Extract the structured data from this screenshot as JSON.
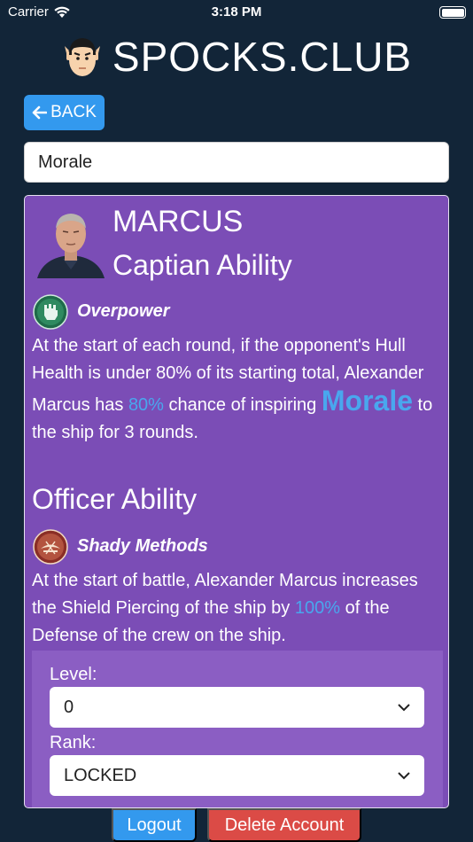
{
  "status_bar": {
    "carrier": "Carrier",
    "time": "3:18 PM"
  },
  "brand": {
    "title": "SPOCKS.CLUB",
    "logo_icon": "spock-face-icon"
  },
  "nav": {
    "back_label": "BACK",
    "back_icon": "arrow-left-icon"
  },
  "search": {
    "value": "Morale"
  },
  "officer": {
    "name": "MARCUS",
    "captain_heading": "Captian Ability",
    "captain_ability": {
      "name": "Overpower",
      "icon": "fist-icon",
      "text_1": "At the start of each round, if the opponent's Hull Health is under 80% of its starting total, Alexander Marcus has ",
      "chance": "80%",
      "text_2": " chance of inspiring ",
      "effect": "Morale",
      "text_3": " to the ship for 3 rounds."
    },
    "officer_heading": "Officer Ability",
    "officer_ability": {
      "name": "Shady Methods",
      "icon": "shady-methods-icon",
      "text_1": "At the start of battle, Alexander Marcus increases the Shield Piercing of the ship by ",
      "percent": "100%",
      "text_2": " of the Defense of the crew on the ship."
    }
  },
  "settings": {
    "level_label": "Level:",
    "level_value": "0",
    "rank_label": "Rank:",
    "rank_value": "LOCKED"
  },
  "footer": {
    "logout_label": "Logout",
    "delete_label": "Delete Account"
  },
  "colors": {
    "background": "#122538",
    "card": "#7b4db6",
    "accent": "#3399ee",
    "highlight": "#49a7ee",
    "danger": "#db4b46"
  }
}
